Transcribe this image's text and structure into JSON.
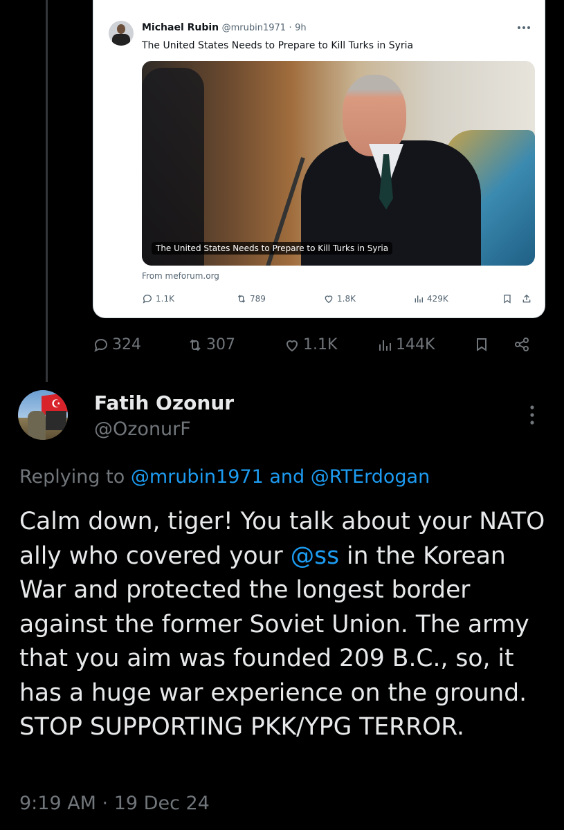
{
  "quoted_tweet": {
    "author_name": "Michael Rubin",
    "handle": "@mrubin1971",
    "separator": "·",
    "time": "9h",
    "more_icon": "more-horizontal-icon",
    "text": "The United States Needs to Prepare to Kill Turks in Syria",
    "image_caption": "The United States Needs to Prepare to Kill Turks in Syria",
    "source": "From meforum.org",
    "replies": "1.1K",
    "retweets": "789",
    "likes": "1.8K",
    "views": "429K"
  },
  "tweet_actions": {
    "replies": "324",
    "retweets": "307",
    "likes": "1.1K",
    "views": "144K"
  },
  "reply": {
    "display_name": "Fatih Ozonur",
    "handle": "@OzonurF",
    "replying_prefix": "Replying to",
    "mention_1": "@mrubin1971",
    "replying_and": "and",
    "mention_2": "@RTErdogan",
    "body_part1": "Calm down, tiger! You talk about your NATO ally who covered your ",
    "body_mention": "@ss",
    "body_part2": " in the Korean War and protected the longest border against the former Soviet Union. The army that you aim was founded 209 B.C., so, it has a huge war experience on the ground.  STOP SUPPORTING PKK/YPG TERROR.",
    "timestamp": "9:19 AM · 19 Dec 24"
  },
  "colors": {
    "background": "#000000",
    "text": "#e7e9ea",
    "muted": "#71767b",
    "accent": "#1d9bf0"
  }
}
